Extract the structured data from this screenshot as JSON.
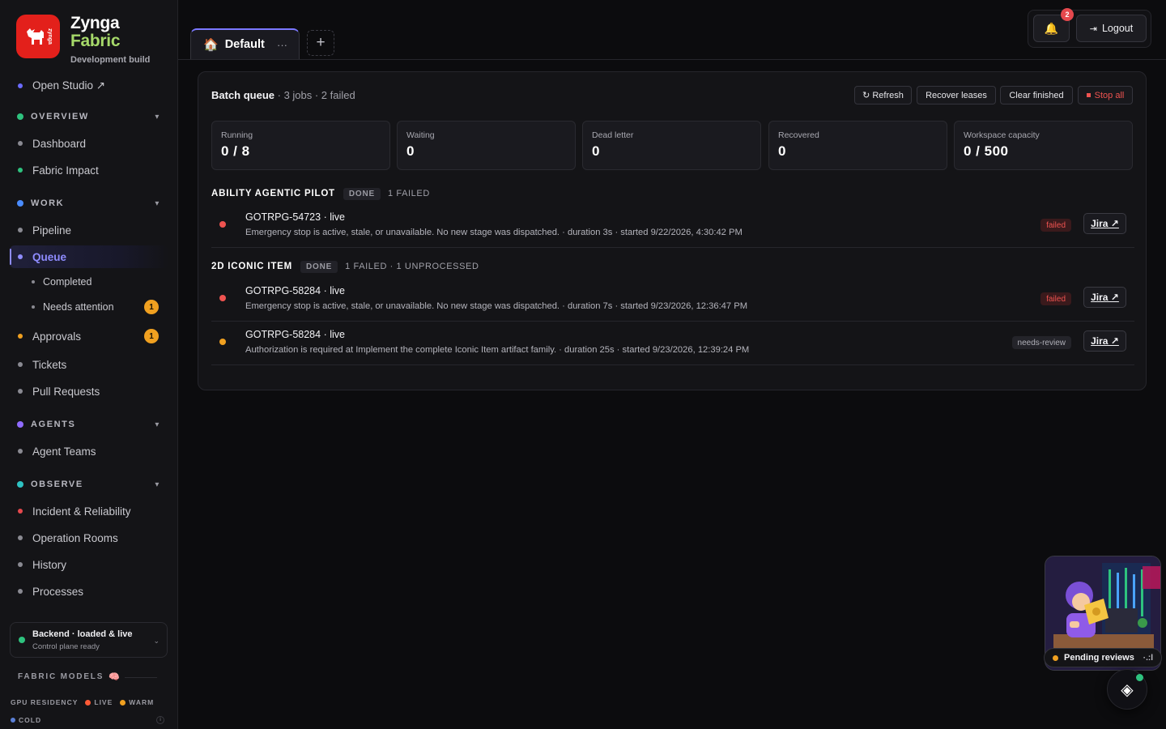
{
  "brand": {
    "logo_text": "zynga",
    "name_line1": "Zynga",
    "name_line2": "Fabric",
    "subtitle": "Development build"
  },
  "sidebar": {
    "open_studio": "Open Studio ↗",
    "sections": {
      "overview": "OVERVIEW",
      "work": "WORK",
      "agents": "AGENTS",
      "observe": "OBSERVE"
    },
    "items": {
      "dashboard": "Dashboard",
      "fabric_impact": "Fabric Impact",
      "pipeline": "Pipeline",
      "queue": "Queue",
      "completed": "Completed",
      "needs_attention": "Needs attention",
      "needs_attention_count": "1",
      "approvals": "Approvals",
      "approvals_count": "1",
      "tickets": "Tickets",
      "pull_requests": "Pull Requests",
      "agent_teams": "Agent Teams",
      "incident": "Incident & Reliability",
      "operation_rooms": "Operation Rooms",
      "history": "History",
      "processes": "Processes"
    },
    "backend": {
      "title": "Backend · loaded & live",
      "subtitle": "Control plane ready"
    },
    "fabric_models": {
      "title": "FABRIC MODELS",
      "gpu_label": "GPU RESIDENCY",
      "live": "LIVE",
      "warm": "WARM",
      "cold": "COLD",
      "info": "i"
    }
  },
  "tabs": {
    "active_label": "Default",
    "more": "···",
    "add": "+"
  },
  "header": {
    "notifications_count": "2",
    "logout": "Logout"
  },
  "queue": {
    "title": "Batch queue",
    "summary": " · 3 jobs · 2 failed",
    "buttons": {
      "refresh": "↻ Refresh",
      "recover": "Recover leases",
      "clear": "Clear finished",
      "stop": "Stop all"
    },
    "stats": [
      {
        "label": "Running",
        "value": "0 / 8"
      },
      {
        "label": "Waiting",
        "value": "0"
      },
      {
        "label": "Dead letter",
        "value": "0"
      },
      {
        "label": "Recovered",
        "value": "0"
      },
      {
        "label": "Workspace capacity",
        "value": "0 / 500"
      }
    ],
    "groups": [
      {
        "name": "ABILITY AGENTIC PILOT",
        "status": "DONE",
        "summary": "1 FAILED",
        "jobs": [
          {
            "title": "GOTRPG-54723 · live",
            "desc": "Emergency stop is active, stale, or unavailable. No new stage was dispatched. · duration 3s · started 9/22/2026, 4:30:42 PM",
            "status": "failed",
            "link": "Jira ↗"
          }
        ]
      },
      {
        "name": "2D ICONIC ITEM",
        "status": "DONE",
        "summary": "1 FAILED · 1 UNPROCESSED",
        "jobs": [
          {
            "title": "GOTRPG-58284 · live",
            "desc": "Emergency stop is active, stale, or unavailable. No new stage was dispatched. · duration 7s · started 9/23/2026, 12:36:47 PM",
            "status": "failed",
            "link": "Jira ↗"
          },
          {
            "title": "GOTRPG-58284 · live",
            "desc": "Authorization is required at Implement the complete Iconic Item artifact family. · duration 25s · started 9/23/2026, 12:39:24 PM",
            "status": "needs-review",
            "link": "Jira ↗"
          }
        ]
      }
    ]
  },
  "floating": {
    "pending_reviews": "Pending reviews",
    "more": "·.:l",
    "fab_icon": "◈"
  },
  "colors": {
    "accent": "#8f8cff",
    "failed": "#ef5350",
    "warning": "#f0a020",
    "live": "#2ec27e",
    "brand_red": "#e3201b"
  }
}
